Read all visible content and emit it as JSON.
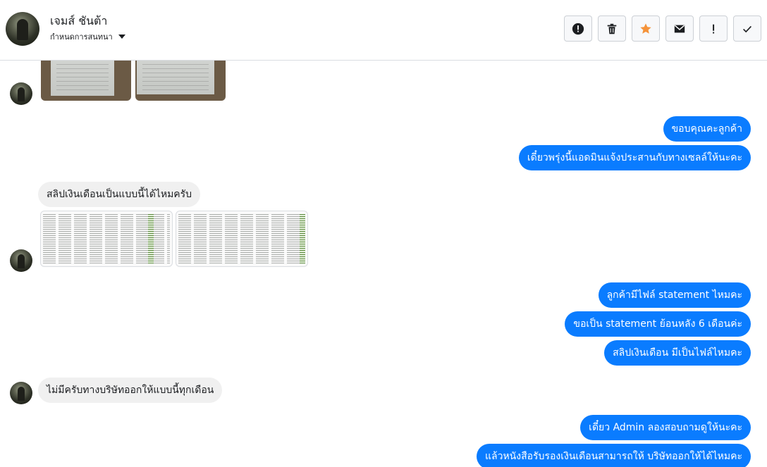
{
  "header": {
    "name": "เจมส์ ชันต้า",
    "subtitle": "กำหนดการสนทนา",
    "actions": [
      "report-icon",
      "trash-icon",
      "star-icon",
      "mail-icon",
      "exclamation-icon",
      "check-icon"
    ],
    "star_color": "#f5933a"
  },
  "messages": {
    "out1": "ขอบคุณคะลูกค้า",
    "out2": "เดี๋ยวพรุ่งนี้แอดมินแจ้งประสานกับทางเซลล์ให้นะคะ",
    "in1": "สลิปเงินเดือนเป็นแบบนี้ได้ไหมครับ",
    "out3": "ลูกค้ามีไฟล์ statement ไหมคะ",
    "out4": "ขอเป็น statement ย้อนหลัง 6 เดือนค่ะ",
    "out5": "สลิปเงินเดือน มีเป็นไฟล์ไหมคะ",
    "in2": "ไม่มีครับทางบริษัทออกให้แบบนี้ทุกเดือน",
    "out6": "เดี๋ยว Admin ลองสอบถามดูให้นะคะ",
    "out7": "แล้วหนังสือรับรองเงินเดือนสามารถให้ บริษัทออกให้ได้ไหมคะ"
  },
  "colors": {
    "outgoing_bubble": "#0a7cff",
    "incoming_bubble": "#f0f0f0"
  }
}
